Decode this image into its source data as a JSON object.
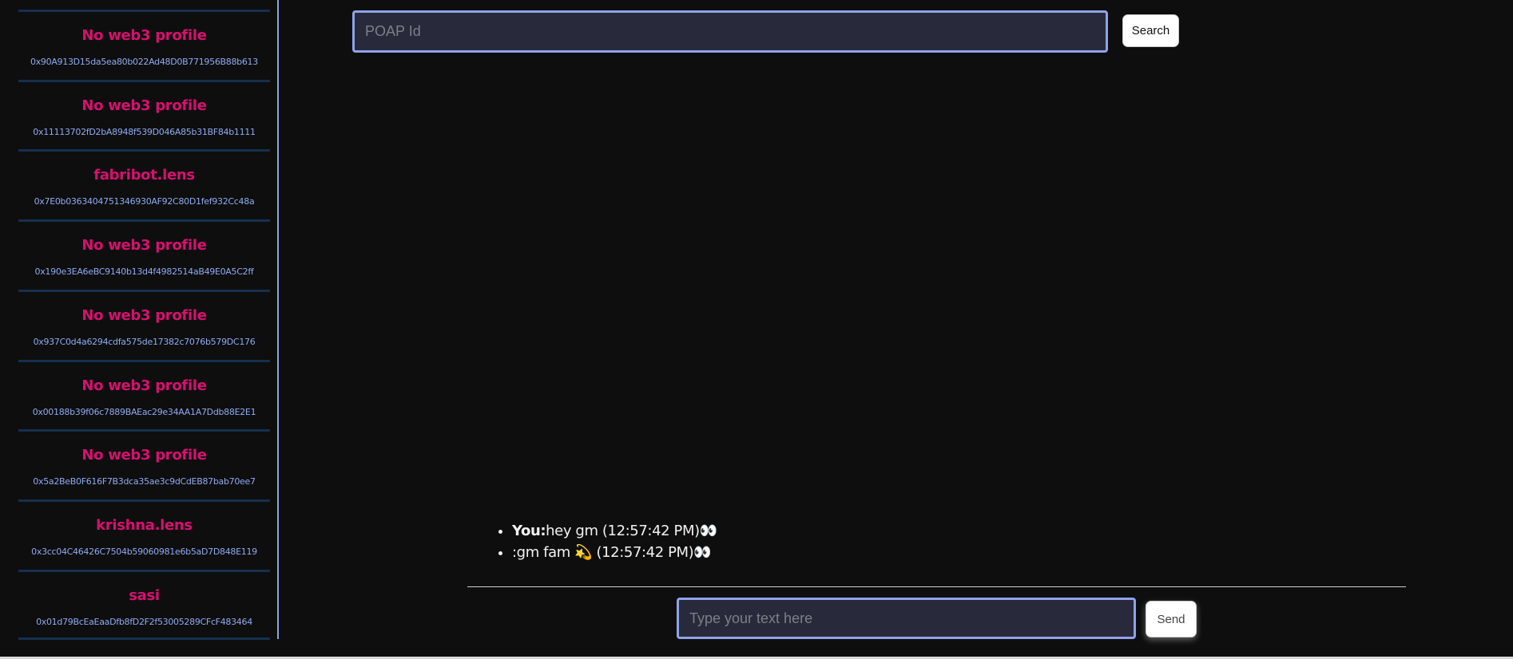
{
  "sidebar": {
    "profiles": [
      {
        "name": "No web3 profile",
        "address": "0x90A913D15da5ea80b022Ad48D0B771956B88b613"
      },
      {
        "name": "No web3 profile",
        "address": "0x11113702fD2bA8948f539D046A85b31BF84b1111"
      },
      {
        "name": "fabribot.lens",
        "address": "0x7E0b0363404751346930AF92C80D1fef932Cc48a"
      },
      {
        "name": "No web3 profile",
        "address": "0x190e3EA6eBC9140b13d4f4982514aB49E0A5C2ff"
      },
      {
        "name": "No web3 profile",
        "address": "0x937C0d4a6294cdfa575de17382c7076b579DC176"
      },
      {
        "name": "No web3 profile",
        "address": "0x00188b39f06c7889BAEac29e34AA1A7Ddb88E2E1"
      },
      {
        "name": "No web3 profile",
        "address": "0x5a2BeB0F616F7B3dca35ae3c9dCdEB87bab70ee7"
      },
      {
        "name": "krishna.lens",
        "address": "0x3cc04C46426C7504b59060981e6b5aD7D848E119"
      },
      {
        "name": "sasi",
        "address": "0x01d79BcEaEaaDfb8fD2F2f53005289CFcF483464"
      }
    ]
  },
  "search": {
    "placeholder": "POAP Id",
    "value": "",
    "button_label": "Search"
  },
  "chat": {
    "messages": [
      {
        "sender": "You:",
        "text": "hey gm (12:57:42 PM)",
        "reaction": "👀"
      },
      {
        "sender": "",
        "text": ":gm fam 💫 (12:57:42 PM)",
        "reaction": "👀"
      }
    ],
    "input_placeholder": "Type your text here",
    "input_value": "",
    "send_label": "Send"
  },
  "colors": {
    "background": "#0e0e0f",
    "profile_name": "#d8106f",
    "address": "#8eabf0",
    "accent_border": "#8ea3e8",
    "divider": "#15304d"
  }
}
